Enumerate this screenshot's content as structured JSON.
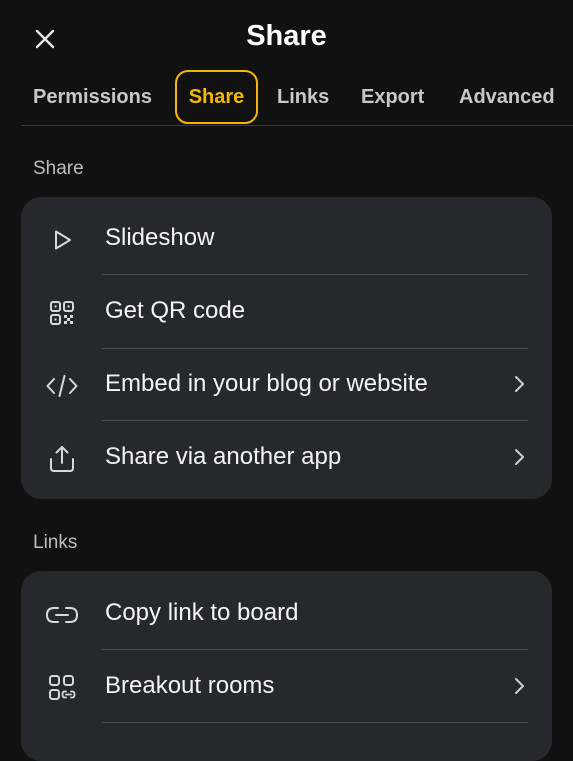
{
  "header": {
    "title": "Share",
    "close_icon": "close-icon"
  },
  "tabs": [
    {
      "label": "Permissions",
      "active": false
    },
    {
      "label": "Share",
      "active": true
    },
    {
      "label": "Links",
      "active": false
    },
    {
      "label": "Export",
      "active": false
    },
    {
      "label": "Advanced",
      "active": false
    }
  ],
  "sections": {
    "share": {
      "label": "Share",
      "items": [
        {
          "label": "Slideshow",
          "icon": "play-icon",
          "has_chevron": false
        },
        {
          "label": "Get QR code",
          "icon": "qr-code-icon",
          "has_chevron": false
        },
        {
          "label": "Embed in your blog or website",
          "icon": "code-icon",
          "has_chevron": true
        },
        {
          "label": "Share via another app",
          "icon": "upload-share-icon",
          "has_chevron": true
        }
      ]
    },
    "links": {
      "label": "Links",
      "items": [
        {
          "label": "Copy link to board",
          "icon": "link-icon",
          "has_chevron": false
        },
        {
          "label": "Breakout rooms",
          "icon": "breakout-rooms-icon",
          "has_chevron": true
        }
      ]
    }
  },
  "colors": {
    "background": "#111111",
    "card": "#27282b",
    "accent": "#f5b800",
    "text": "#f4f4f4",
    "muted": "#bdbdbd"
  }
}
